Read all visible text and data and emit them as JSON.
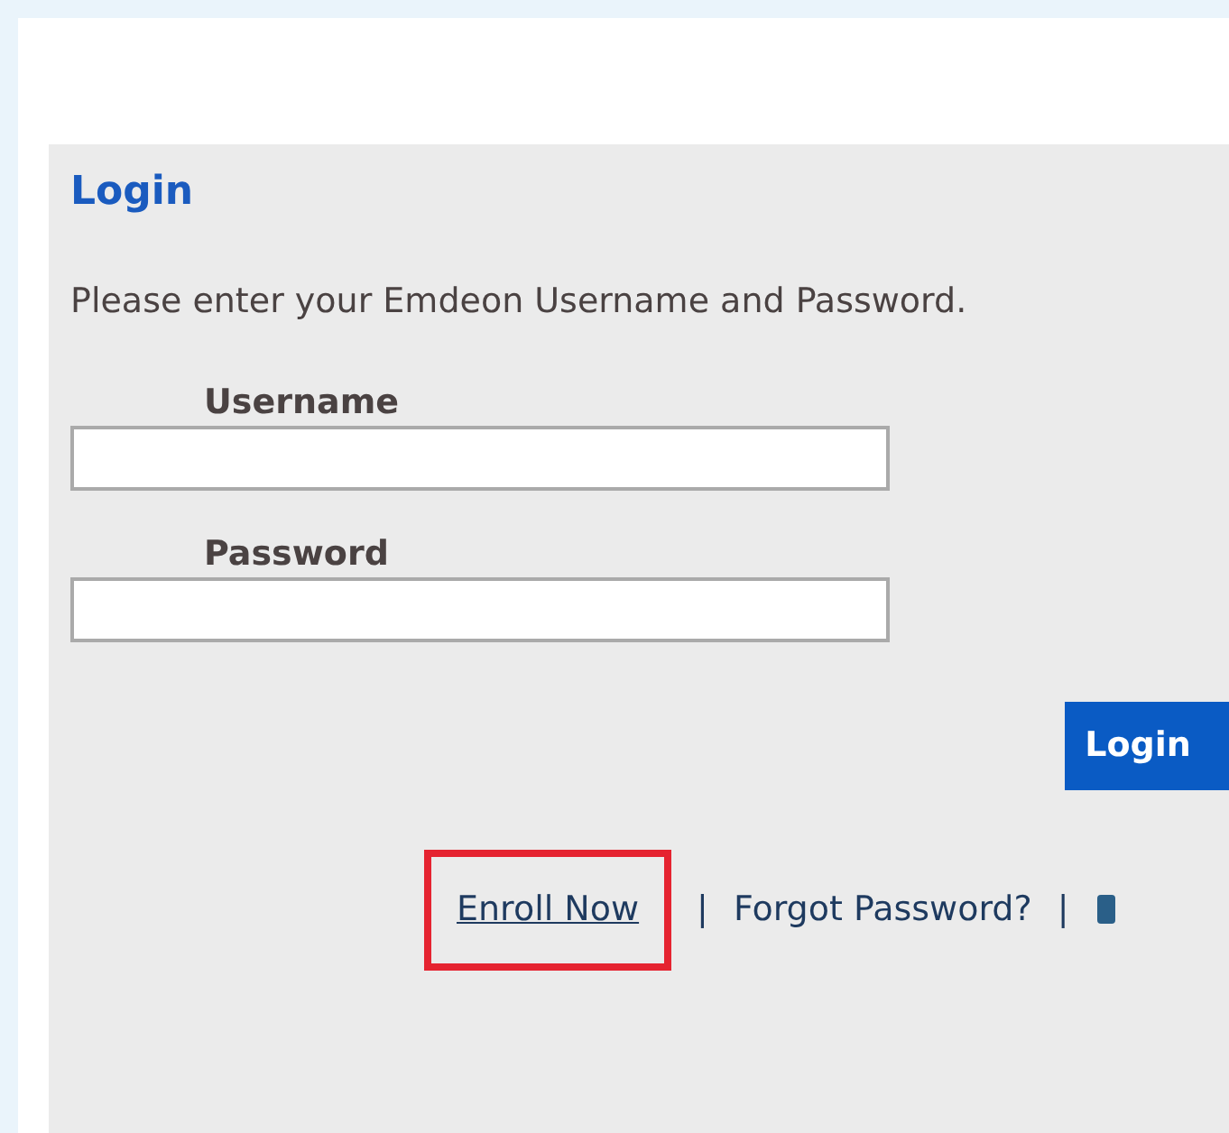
{
  "login_panel": {
    "title": "Login",
    "instructions": "Please enter your Emdeon Username and Password.",
    "fields": [
      {
        "label": "Username"
      },
      {
        "label": "Password"
      }
    ],
    "submit_button": "Login",
    "links": [
      {
        "label": "Enroll Now",
        "highlighted": true
      },
      {
        "label": "Forgot Password?",
        "highlighted": false
      }
    ],
    "separator": "|"
  }
}
